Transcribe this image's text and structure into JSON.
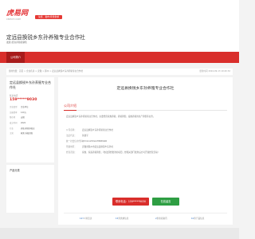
{
  "header": {
    "logo_text": "虎易网",
    "logo_sub": "CNHUYI.COM",
    "badge": "免费、发布/查找供求",
    "company_title": "定远县换锐乡东孙养殖专业合作社",
    "company_sub": "发展.招商养殖和销售"
  },
  "nav": {
    "home": "公司简介"
  },
  "breadcrumb": {
    "path": "您的位置：首页 > 企业名录 > 安徽 > 滁州 > 定远县换锐乡东孙养殖专业合作社",
    "time": "更新时间 2024-09-13 10:40:32"
  },
  "left": {
    "company_name": "定远县换锐乡东孙养殖专业合作社",
    "phone_label": "联系电话",
    "phone": "159*****9030",
    "info": [
      {
        "k": "企业类型",
        "v": "企业单位"
      },
      {
        "k": "注册资本",
        "v": "120万"
      },
      {
        "k": "所在地",
        "v": "安徽"
      },
      {
        "k": "成立时间",
        "v": "2020"
      },
      {
        "k": "行业",
        "v": "养殖  家禽养殖业"
      },
      {
        "k": "主营",
        "v": "家禽  养殖销售"
      }
    ],
    "products_title": "产品分类"
  },
  "main": {
    "title": "定远县换锐乡东孙养殖专业合作社",
    "section_title": "公司介绍",
    "intro": "定远县换锐乡东孙养殖专业合作社，主要经营家禽养殖；养殖销售；畜禽养殖的生产销售等业务。",
    "fields": [
      {
        "k": "公司名称：",
        "v": "定远县换锐乡东孙养殖专业合作社"
      },
      {
        "k": "法定代表：",
        "v": "孙建军"
      },
      {
        "k": "统一社会信用代码：",
        "v": "93341125MA2TBBEN4B"
      },
      {
        "k": "所属地区：",
        "v": "安徽省滁州市定远县换锐乡东孙村"
      },
      {
        "k": "经营范围：",
        "v": "家禽、家畜养殖销售；（依法须经批准的项目，经相关部门批准后方可开展经营活动）"
      }
    ],
    "call_button": "联系电话：159*****9030",
    "mail_button": "在线留言",
    "stats": [
      {
        "num": "127",
        "label": "人浏览过"
      },
      {
        "num": "15",
        "label": "条供求信息"
      },
      {
        "num": "2",
        "label": "条新闻资讯"
      },
      {
        "num": "10",
        "label": "条产品信息"
      }
    ]
  }
}
